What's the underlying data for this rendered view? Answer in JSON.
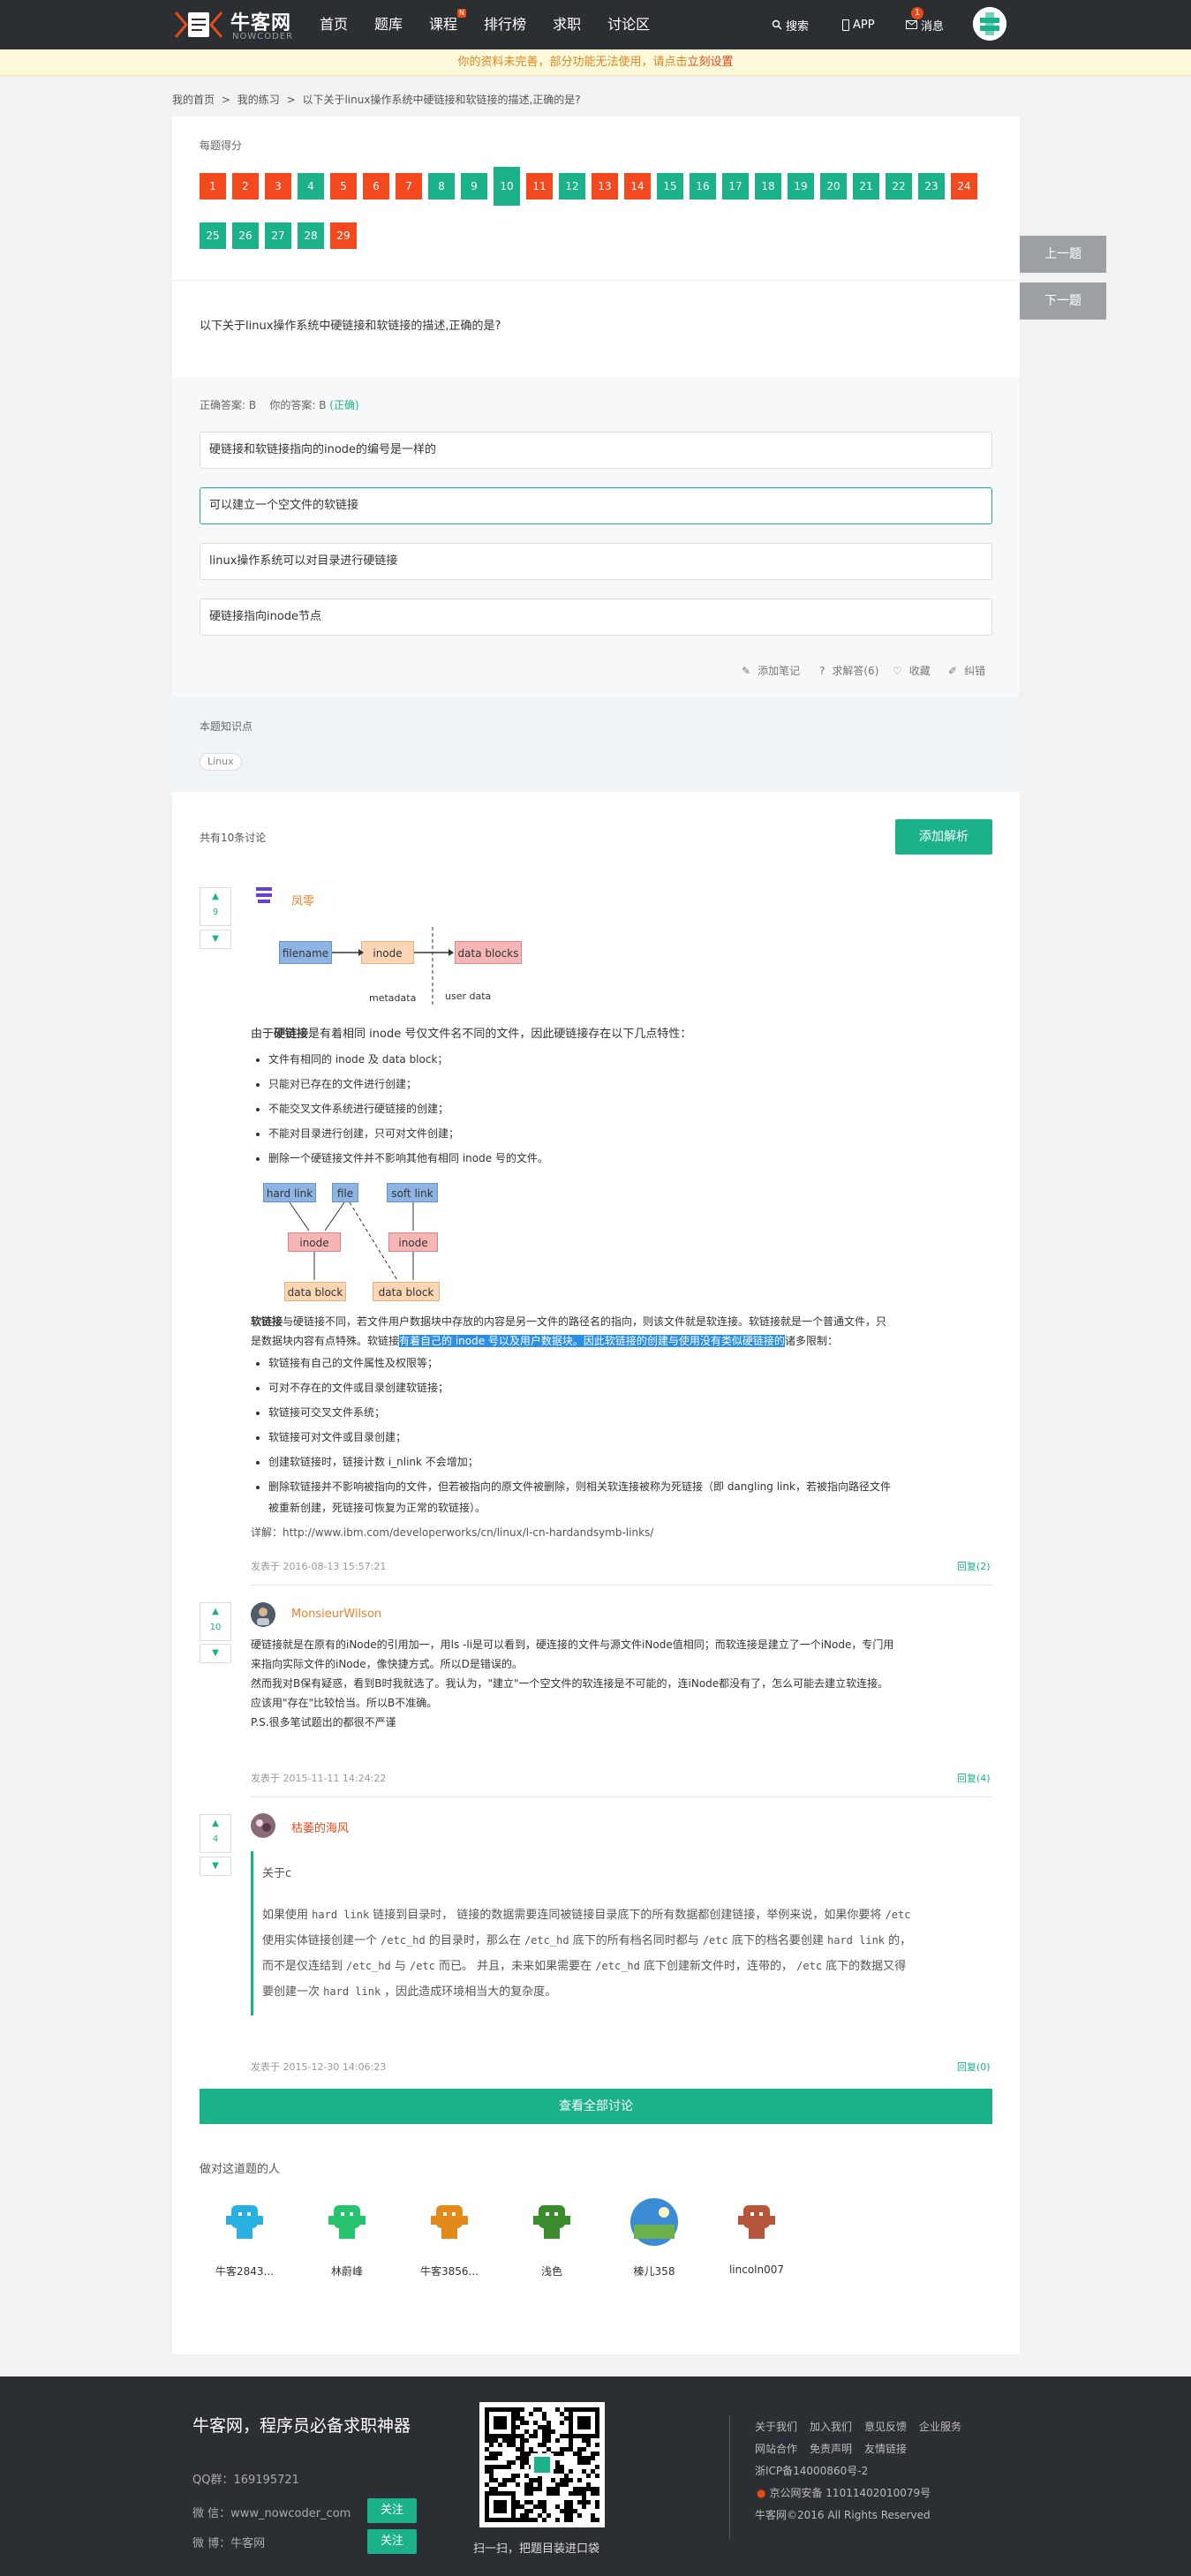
{
  "topbar": {
    "logo_text": "牛客网",
    "logo_sub": "NOWCODER",
    "nav": [
      {
        "label": "首页"
      },
      {
        "label": "题库"
      },
      {
        "label": "课程",
        "badge": "N"
      },
      {
        "label": "排行榜"
      },
      {
        "label": "求职"
      },
      {
        "label": "讨论区"
      }
    ],
    "search_label": "搜索",
    "app_label": "APP",
    "msg_label": "消息",
    "msg_count": "1"
  },
  "notice": {
    "text": "你的资料未完善，部分功能无法使用，请点击",
    "link": "立刻设置"
  },
  "breadcrumb": [
    "我的首页",
    ">",
    "我的练习",
    ">",
    "以下关于linux操作系统中硬链接和软链接的描述,正确的是?"
  ],
  "score": {
    "label": "每题得分",
    "items": [
      {
        "n": "1",
        "s": "r"
      },
      {
        "n": "2",
        "s": "r"
      },
      {
        "n": "3",
        "s": "r"
      },
      {
        "n": "4",
        "s": "g"
      },
      {
        "n": "5",
        "s": "r"
      },
      {
        "n": "6",
        "s": "r"
      },
      {
        "n": "7",
        "s": "r"
      },
      {
        "n": "8",
        "s": "g"
      },
      {
        "n": "9",
        "s": "g"
      },
      {
        "n": "10",
        "s": "g"
      },
      {
        "n": "11",
        "s": "r"
      },
      {
        "n": "12",
        "s": "g"
      },
      {
        "n": "13",
        "s": "r"
      },
      {
        "n": "14",
        "s": "r"
      },
      {
        "n": "15",
        "s": "g"
      },
      {
        "n": "16",
        "s": "g"
      },
      {
        "n": "17",
        "s": "g"
      },
      {
        "n": "18",
        "s": "g"
      },
      {
        "n": "19",
        "s": "g"
      },
      {
        "n": "20",
        "s": "g"
      },
      {
        "n": "21",
        "s": "g"
      },
      {
        "n": "22",
        "s": "g"
      },
      {
        "n": "23",
        "s": "g"
      },
      {
        "n": "24",
        "s": "r"
      },
      {
        "n": "25",
        "s": "g"
      },
      {
        "n": "26",
        "s": "g"
      },
      {
        "n": "27",
        "s": "g"
      },
      {
        "n": "28",
        "s": "g"
      },
      {
        "n": "29",
        "s": "r"
      }
    ],
    "current": "10"
  },
  "side": {
    "prev": "上一题",
    "next": "下一题"
  },
  "question": {
    "text": "以下关于linux操作系统中硬链接和软链接的描述,正确的是?"
  },
  "answer": {
    "correct_label": "正确答案: B",
    "yours_label": "你的答案: B",
    "status": "(正确)",
    "options": [
      "硬链接和软链接指向的inode的编号是一样的",
      "可以建立一个空文件的软链接",
      "linux操作系统可以对目录进行硬链接",
      "硬链接指向inode节点"
    ],
    "selected_index": 1,
    "tools": [
      "添加笔记",
      "求解答(6)",
      "收藏",
      "纠错"
    ]
  },
  "knowledge": {
    "label": "本题知识点",
    "tag": "Linux"
  },
  "discussion": {
    "count_label": "共有10条讨论",
    "add_label": "添加解析",
    "c1": {
      "votes": "9",
      "user": "凤零",
      "d1": {
        "filename": "filename",
        "inode": "inode",
        "datablocks": "data blocks",
        "metadata": "metadata",
        "userdata": "user data"
      },
      "intro_pre": "由于",
      "intro_b": "硬链接",
      "intro_post": "是有着相同 inode 号仅文件名不同的文件，因此硬链接存在以下几点特性：",
      "hard": [
        "文件有相同的 inode 及 data block；",
        "只能对已存在的文件进行创建；",
        "不能交叉文件系统进行硬链接的创建；",
        "不能对目录进行创建，只可对文件创建；",
        "删除一个硬链接文件并不影响其他有相同 inode 号的文件。"
      ],
      "d2": {
        "hardlink": "hard link",
        "file": "file",
        "softlink": "soft link",
        "inode": "inode",
        "datablock": "data block"
      },
      "soft_b": "软链接",
      "soft_a": "与硬链接不同，若文件用户数据块中存放的内容是另一文件的路径名的指向，则该文件就是软连接。软链接就是一个普通文件，只",
      "soft_c": "是数据块内容有点特殊。软链接",
      "soft_hl": "有着自己的 inode 号以及用户数据块。因此软链接的创建与使用没有类似硬链接的",
      "soft_d": "诸多限制：",
      "soft": [
        "软链接有自己的文件属性及权限等；",
        "可对不存在的文件或目录创建软链接；",
        "软链接可交叉文件系统；",
        "软链接可对文件或目录创建；",
        "创建软链接时，链接计数 i_nlink 不会增加；",
        "删除软链接并不影响被指向的文件，但若被指向的原文件被删除，则相关软连接被称为死链接（即 dangling link，若被指向路径文件"
      ],
      "soft_tail": "被重新创建，死链接可恢复为正常的软链接）。",
      "detail": "详解：http://www.ibm.com/developerworks/cn/linux/l-cn-hardandsymb-links/",
      "time": "发表于 2016-08-13 15:57:21",
      "reply": "回复(2)"
    },
    "c2": {
      "votes": "10",
      "user": "MonsieurWilson",
      "l1": "硬链接就是在原有的iNode的引用加一，用ls -li是可以看到，硬连接的文件与源文件iNode值相同；而软连接是建立了一个iNode，专门用",
      "l2": "来指向实际文件的iNode，像快捷方式。所以D是错误的。",
      "l3": "然而我对B保有疑惑，看到B时我就选了。我认为，\"建立\"一个空文件的软连接是不可能的，连iNode都没有了，怎么可能去建立软连接。",
      "l4": "应该用\"存在\"比较恰当。所以B不准确。",
      "l5": "P.S.很多笔试题出的都很不严谨",
      "time": "发表于 2015-11-11 14:24:22",
      "reply": "回复(4)"
    },
    "c3": {
      "votes": "4",
      "user": "枯萎的海风",
      "q1": "关于c",
      "q2a": "如果使用 ",
      "q2b": "hard link",
      "q2c": " 链接到目录时， 链接的数据需要连同被链接目录底下的所有数据都创建链接，举例来说，如果你要将 ",
      "q2d": "/etc",
      "q3a": "使用实体链接创建一个 ",
      "q3b": "/etc_hd",
      "q3c": " 的目录时，那么在 ",
      "q3d": "/etc_hd",
      "q3e": " 底下的所有档名同时都与 ",
      "q3f": "/etc",
      "q3g": " 底下的档名要创建 ",
      "q3h": "hard link",
      "q3i": " 的，",
      "q4a": "而不是仅连结到 ",
      "q4b": "/etc_hd",
      "q4c": " 与 ",
      "q4d": "/etc",
      "q4e": " 而已。 并且，未来如果需要在 ",
      "q4f": "/etc_hd",
      "q4g": " 底下创建新文件时，连带的， ",
      "q4h": "/etc",
      "q4i": " 底下的数据又得",
      "q5a": "要创建一次 ",
      "q5b": "hard link",
      "q5c": " ，因此造成环境相当大的复杂度。",
      "time": "发表于 2015-12-30 14:06:23",
      "reply": "回复(0)"
    },
    "view_all": "查看全部讨论"
  },
  "people": {
    "label": "做对这道题的人",
    "list": [
      {
        "name": "牛客2843...",
        "color": "#29b0e0",
        "icon": "avatar-icon"
      },
      {
        "name": "林蔚峰",
        "color": "#27c36f",
        "icon": "avatar-icon"
      },
      {
        "name": "牛客3856...",
        "color": "#e28a1a",
        "icon": "avatar-icon"
      },
      {
        "name": "浅色",
        "color": "#3b8a2e",
        "icon": "avatar-icon"
      },
      {
        "name": "榛儿358",
        "color": "#3a8ad4",
        "icon": "photo-avatar"
      },
      {
        "name": "lincoln007",
        "color": "#b5553a",
        "icon": "avatar-icon"
      }
    ]
  },
  "footer": {
    "title": "牛客网，程序员必备求职神器",
    "qq": "QQ群：169195721",
    "wechat": "微 信：www_nowcoder_com",
    "weibo": "微 博：牛客网",
    "follow": "关注",
    "scan": "扫一扫，把题目装进口袋",
    "links1": [
      "关于我们",
      "加入我们",
      "意见反馈",
      "企业服务"
    ],
    "links2": [
      "网站合作",
      "免责声明",
      "友情链接"
    ],
    "icp": "浙ICP备14000860号-2",
    "police": "京公网安备 11011402010079号",
    "copyright": "牛客网©2016 All Rights Reserved"
  }
}
